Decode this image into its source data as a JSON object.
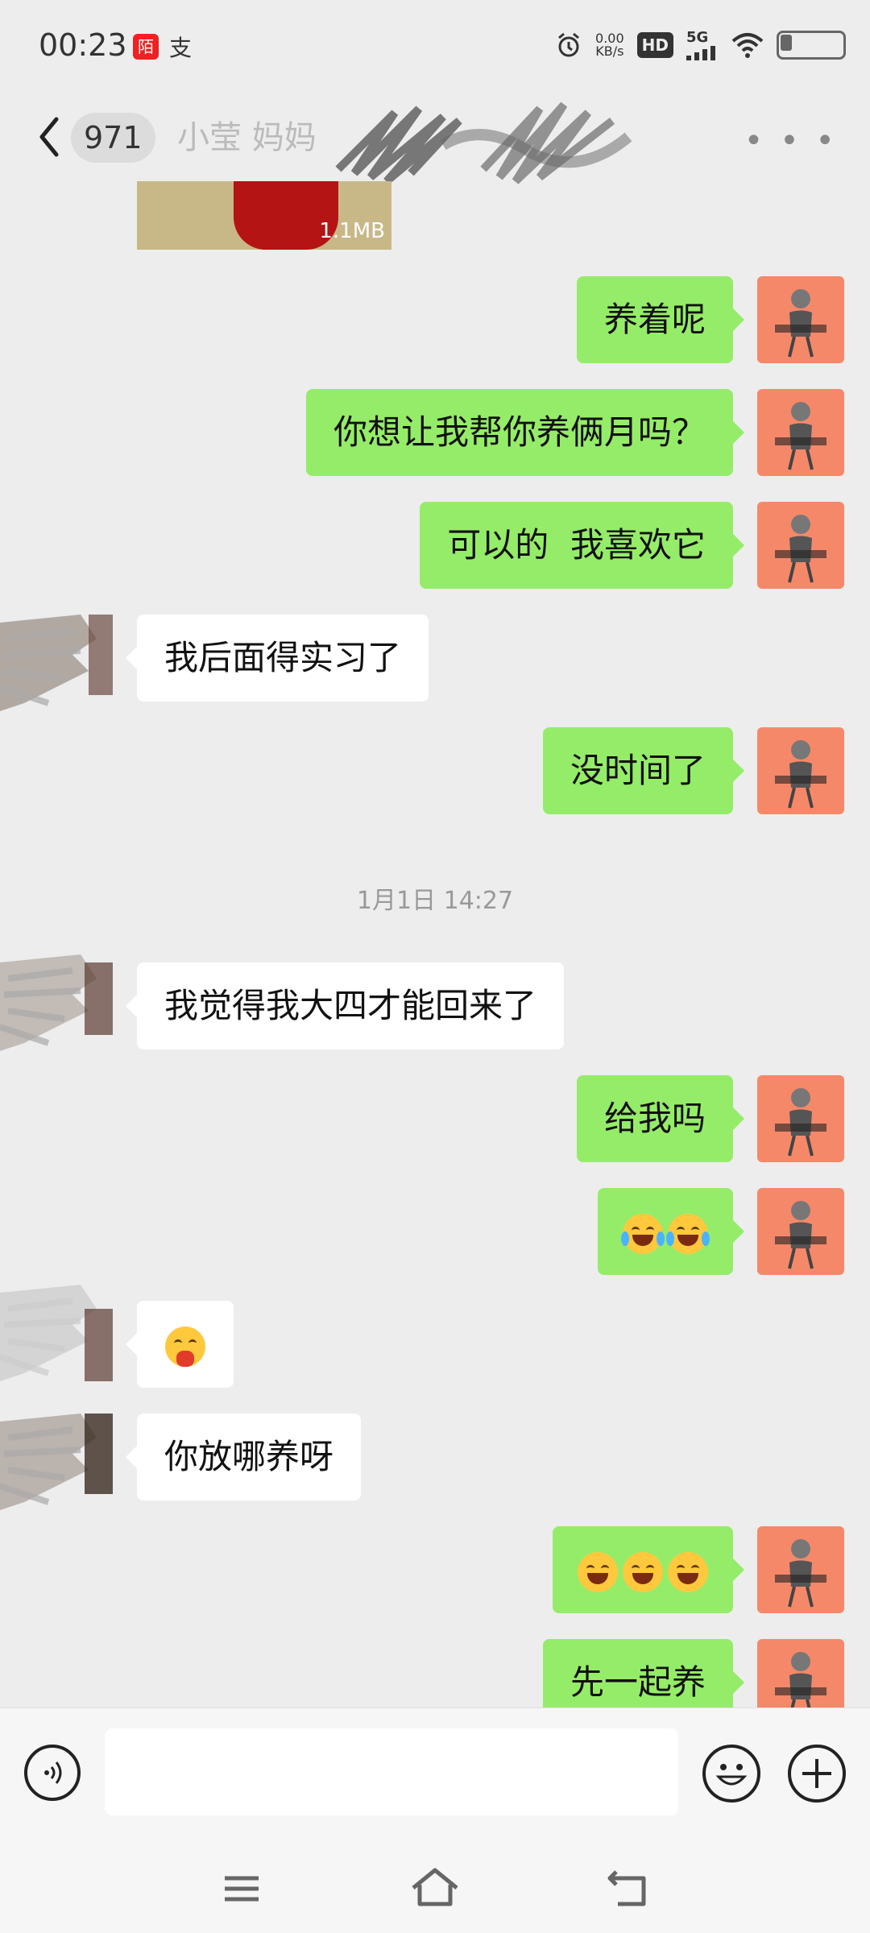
{
  "status_bar": {
    "time": "00:23",
    "app_icon_1": "陌",
    "app_icon_2": "支",
    "net_speed_value": "0.00",
    "net_speed_unit": "KB/s",
    "hd": "HD",
    "network": "5G"
  },
  "header": {
    "unread_count": "971",
    "title": "小莹 妈妈"
  },
  "chat": {
    "image_size": "1.1MB",
    "timestamp": "1月1日 14:27",
    "messages": [
      {
        "side": "mine",
        "text": "养着呢"
      },
      {
        "side": "mine",
        "text": "你想让我帮你养俩月吗？"
      },
      {
        "side": "mine",
        "text": "可以的  我喜欢它"
      },
      {
        "side": "theirs",
        "text": "我后面得实习了"
      },
      {
        "side": "mine",
        "text": "没时间了"
      },
      {
        "side": "theirs",
        "text": "我觉得我大四才能回来了"
      },
      {
        "side": "mine",
        "text": "给我吗"
      },
      {
        "side": "mine",
        "emoji": [
          "cry-laugh",
          "cry-laugh"
        ]
      },
      {
        "side": "theirs",
        "emoji": [
          "eating-face"
        ]
      },
      {
        "side": "theirs",
        "text": "你放哪养呀"
      },
      {
        "side": "mine",
        "emoji": [
          "grin",
          "grin",
          "grin"
        ]
      },
      {
        "side": "mine",
        "text": "先一起养"
      }
    ]
  },
  "input_bar": {
    "placeholder": "",
    "icons": [
      "voice-icon",
      "emoji-icon",
      "plus-icon"
    ]
  },
  "nav_bar": {
    "icons": [
      "menu-icon",
      "home-icon",
      "back-icon"
    ]
  },
  "colors": {
    "my_bubble": "#95ec69",
    "their_bubble": "#ffffff",
    "background": "#ededed",
    "my_avatar": "#f6886a"
  }
}
